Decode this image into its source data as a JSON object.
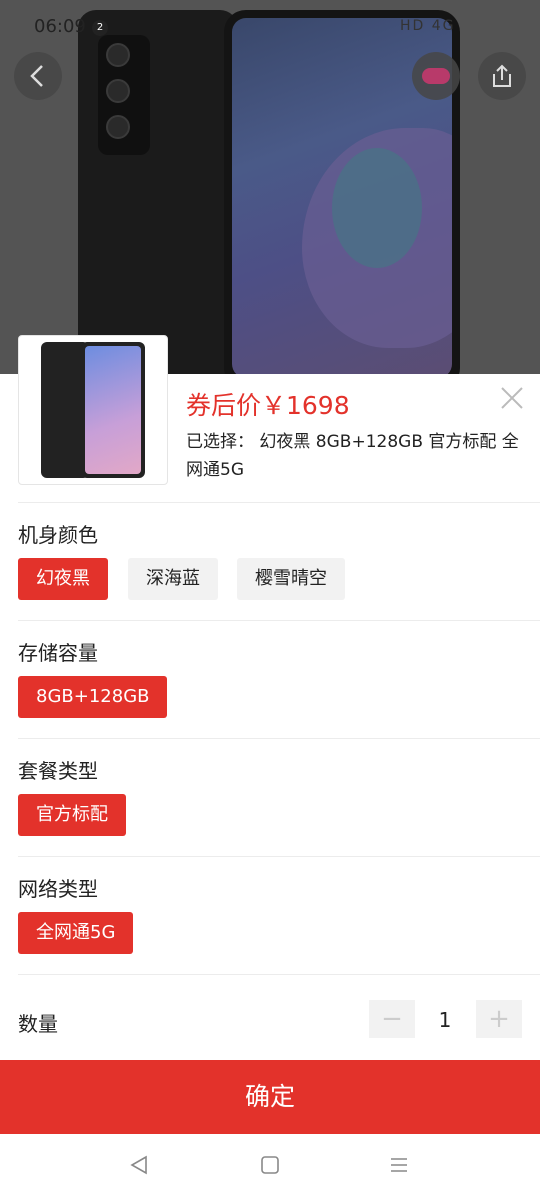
{
  "status_bar": {
    "time": "06:09",
    "notification_count": "2",
    "system_icons": "HD 4G"
  },
  "header": {
    "back_icon": "back-arrow-icon",
    "share_icon": "share-icon"
  },
  "product": {
    "price_label": "券后价￥1698",
    "selected_text": "已选择： 幻夜黑 8GB+128GB 官方标配 全网通5G"
  },
  "sections": [
    {
      "title": "机身颜色",
      "options": [
        "幻夜黑",
        "深海蓝",
        "樱雪晴空"
      ],
      "selected": "幻夜黑"
    },
    {
      "title": "存储容量",
      "options": [
        "8GB+128GB"
      ],
      "selected": "8GB+128GB"
    },
    {
      "title": "套餐类型",
      "options": [
        "官方标配"
      ],
      "selected": "官方标配"
    },
    {
      "title": "网络类型",
      "options": [
        "全网通5G"
      ],
      "selected": "全网通5G"
    }
  ],
  "quantity": {
    "label": "数量",
    "value": "1",
    "minus": "−",
    "plus": "+"
  },
  "confirm_label": "确定",
  "colors": {
    "accent": "#e3322b",
    "unselected_bg": "#f2f2f2"
  }
}
